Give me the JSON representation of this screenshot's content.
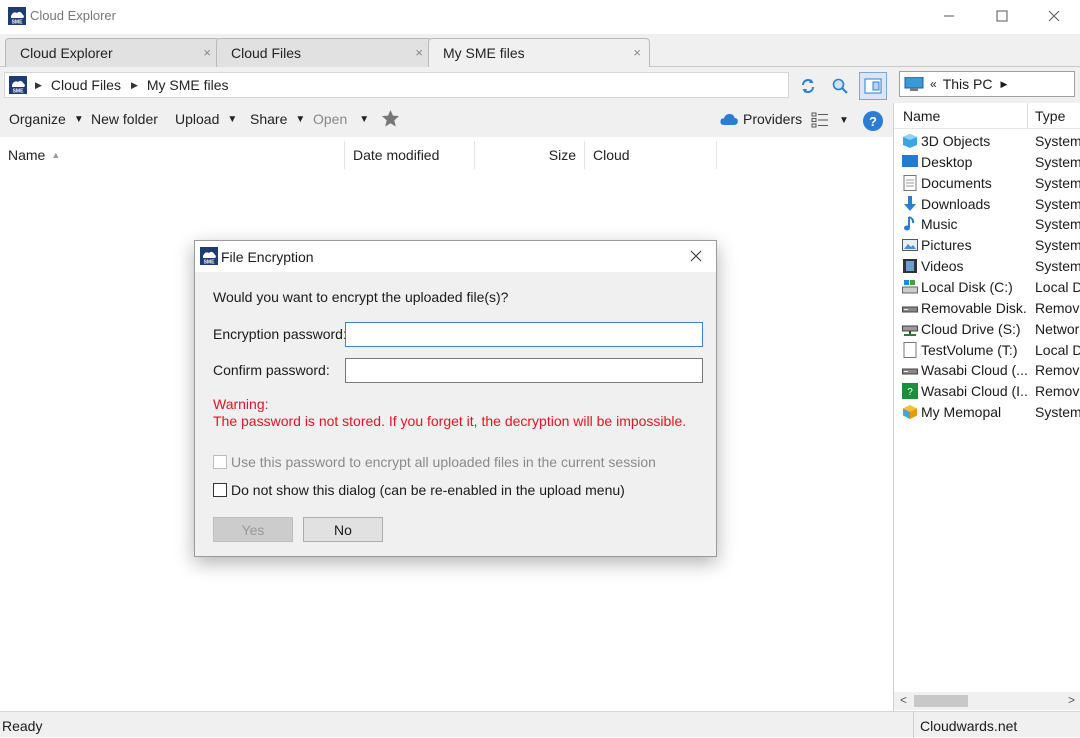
{
  "window": {
    "title": "Cloud Explorer"
  },
  "tabs": [
    {
      "label": "Cloud Explorer",
      "close": "×"
    },
    {
      "label": "Cloud Files",
      "close": "×"
    },
    {
      "label": "My SME files",
      "close": "×"
    }
  ],
  "breadcrumb": {
    "items": [
      "Cloud Files",
      "My SME files"
    ]
  },
  "right_address": {
    "prefix": "«",
    "location": "This PC"
  },
  "toolbar": {
    "organize": "Organize",
    "new_folder": "New folder",
    "upload": "Upload",
    "share": "Share",
    "open": "Open",
    "providers": "Providers",
    "help": "?"
  },
  "columns": {
    "name": "Name",
    "date_modified": "Date modified",
    "size": "Size",
    "cloud": "Cloud"
  },
  "right_panel": {
    "col_name": "Name",
    "col_type": "Type",
    "items": [
      {
        "name": "3D Objects",
        "type": "System",
        "icon": "3d-objects-icon"
      },
      {
        "name": "Desktop",
        "type": "System",
        "icon": "desktop-icon"
      },
      {
        "name": "Documents",
        "type": "System",
        "icon": "documents-icon"
      },
      {
        "name": "Downloads",
        "type": "System",
        "icon": "downloads-icon"
      },
      {
        "name": "Music",
        "type": "System",
        "icon": "music-icon"
      },
      {
        "name": "Pictures",
        "type": "System",
        "icon": "pictures-icon"
      },
      {
        "name": "Videos",
        "type": "System",
        "icon": "videos-icon"
      },
      {
        "name": "Local Disk (C:)",
        "type": "Local Di",
        "icon": "local-disk-icon"
      },
      {
        "name": "Removable Disk...",
        "type": "Remova",
        "icon": "removable-disk-icon"
      },
      {
        "name": "Cloud Drive (S:)",
        "type": "Networ",
        "icon": "network-drive-icon"
      },
      {
        "name": "TestVolume (T:)",
        "type": "Local Di",
        "icon": "volume-icon"
      },
      {
        "name": "Wasabi Cloud (...",
        "type": "Remova",
        "icon": "removable-disk-icon"
      },
      {
        "name": "Wasabi Cloud (I...",
        "type": "Remova",
        "icon": "wasabi-icon"
      },
      {
        "name": "My Memopal",
        "type": "System",
        "icon": "memopal-icon"
      }
    ]
  },
  "status": {
    "left": "Ready",
    "right": "Cloudwards.net"
  },
  "dialog": {
    "title": "File Encryption",
    "question": "Would you want to encrypt the uploaded file(s)?",
    "enc_label": "Encryption password:",
    "confirm_label": "Confirm password:",
    "enc_value": "",
    "confirm_value": "",
    "warning_title": "Warning:",
    "warning_text": "The password is not stored. If you forget it, the decryption will be impossible.",
    "chk_session": "Use this password to encrypt all uploaded files in the current session",
    "chk_noshow": "Do not show this dialog (can be re-enabled in the upload menu)",
    "yes": "Yes",
    "no": "No"
  },
  "colors": {
    "accent": "#2b7cd3",
    "warning": "#e81123"
  }
}
